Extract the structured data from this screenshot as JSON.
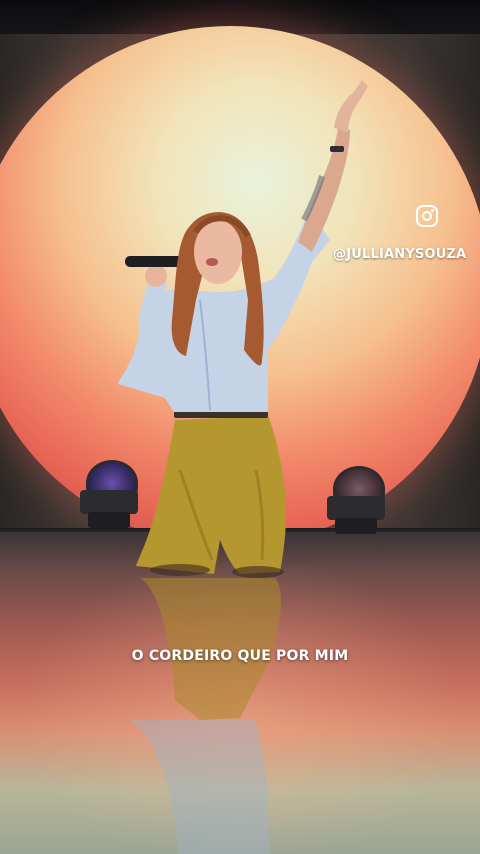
{
  "video": {
    "watermark": {
      "icon": "instagram-icon",
      "handle": "@JULLIANYSOUZA"
    },
    "caption": "O CORDEIRO QUE POR MIM"
  }
}
